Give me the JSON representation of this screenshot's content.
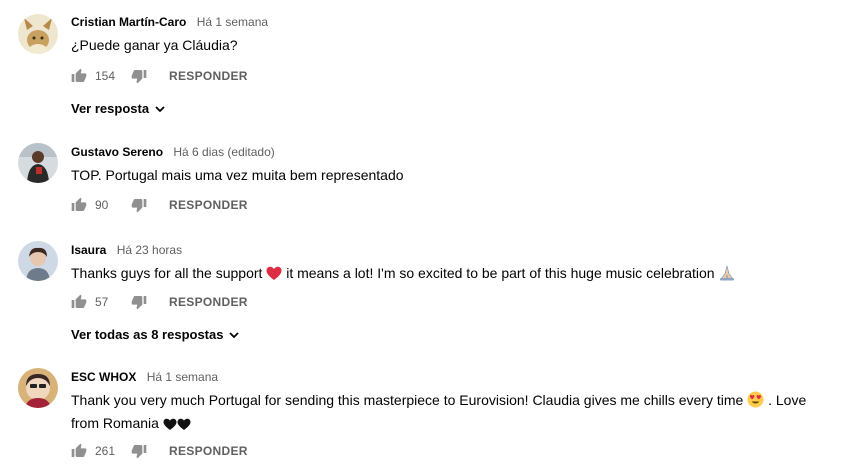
{
  "comments": [
    {
      "author": "Cristian Martín-Caro",
      "time": "Há 1 semana",
      "text": "¿Puede ganar ya Cláudia?",
      "likes": "154",
      "reply_label": "RESPONDER",
      "view_replies": "Ver resposta"
    },
    {
      "author": "Gustavo Sereno",
      "time": "Há 6 dias (editado)",
      "text": "TOP. Portugal mais uma vez muita bem representado",
      "likes": "90",
      "reply_label": "RESPONDER"
    },
    {
      "author": "Isaura",
      "time": "Há 23 horas",
      "text_part1": "Thanks guys for all the support",
      "text_part2": "it means a lot! I'm so excited to be part of this huge music celebration",
      "likes": "57",
      "reply_label": "RESPONDER",
      "view_replies": "Ver todas as 8 respostas"
    },
    {
      "author": "ESC WHOX",
      "time": "Há 1 semana",
      "text_part1": "Thank you very much Portugal for sending this masterpiece to Eurovision! Claudia gives me chills every time",
      "text_part2": ". Love from Romania",
      "likes": "261",
      "reply_label": "RESPONDER"
    }
  ],
  "colors": {
    "text": "#030303",
    "meta": "#606060",
    "icon": "#909090",
    "heart": "#e0245e"
  },
  "icons": [
    "thumb-up-icon",
    "thumb-down-icon",
    "chevron-down-icon",
    "red-heart-emoji",
    "folded-hands-emoji",
    "heart-eyes-emoji",
    "black-heart-emoji"
  ]
}
